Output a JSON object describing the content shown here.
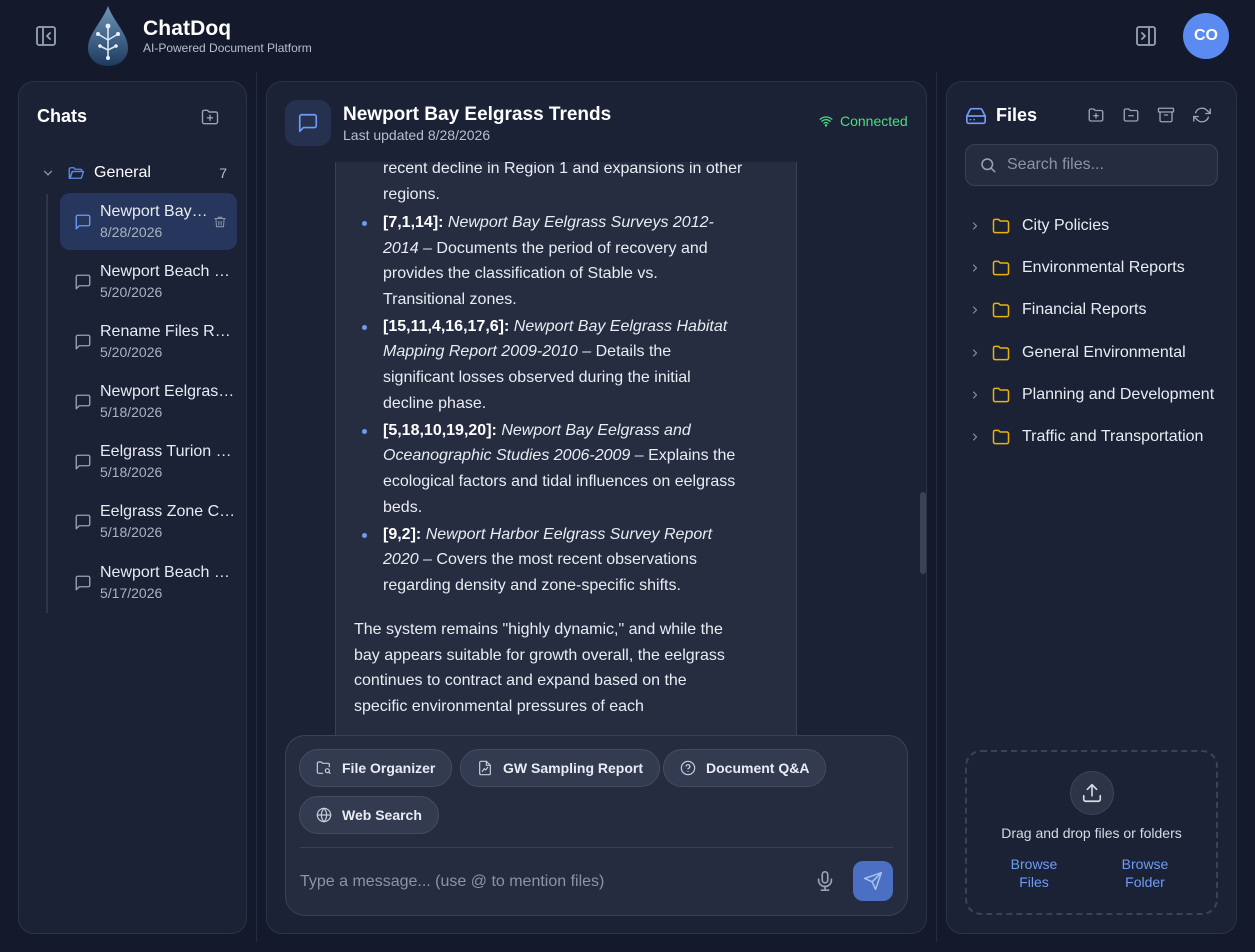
{
  "app": {
    "name": "ChatDoq",
    "tagline": "AI-Powered Document Platform",
    "avatar_initials": "CO",
    "accent": "#5b8bf0",
    "connected_color": "#4ade80",
    "folder_color": "#eab308"
  },
  "sidebar": {
    "title": "Chats",
    "folder": {
      "name": "General",
      "count": "7"
    },
    "chats": [
      {
        "title": "Newport Bay Eelgrass Trends",
        "date": "8/28/2026",
        "active": true
      },
      {
        "title": "Newport Beach Eelgrass",
        "date": "5/20/2026"
      },
      {
        "title": "Rename Files Request",
        "date": "5/20/2026"
      },
      {
        "title": "Newport Eelgrass Zones",
        "date": "5/18/2026"
      },
      {
        "title": "Eelgrass Turion Density",
        "date": "5/18/2026"
      },
      {
        "title": "Eelgrass Zone Classification",
        "date": "5/18/2026"
      },
      {
        "title": "Newport Beach Surveys",
        "date": "5/17/2026"
      }
    ]
  },
  "chat": {
    "title": "Newport Bay Eelgrass Trends",
    "updated": "Last updated 8/28/2026",
    "status": "Connected",
    "message": {
      "continuation": "recent decline in Region 1 and expansions in other regions.",
      "citations": [
        {
          "cite": "[7,1,14]:",
          "doc": "Newport Bay Eelgrass Surveys 2012-2014",
          "desc": "Documents the period of recovery and provides the classification of Stable vs. Transitional zones."
        },
        {
          "cite": "[15,11,4,16,17,6]:",
          "doc": "Newport Bay Eelgrass Habitat Mapping Report 2009-2010",
          "desc": "Details the significant losses observed during the initial decline phase."
        },
        {
          "cite": "[5,18,10,19,20]:",
          "doc": "Newport Bay Eelgrass and Oceanographic Studies 2006-2009",
          "desc": "Explains the ecological factors and tidal influences on eelgrass beds."
        },
        {
          "cite": "[9,2]:",
          "doc": "Newport Harbor Eelgrass Survey Report 2020",
          "desc": "Covers the most recent observations regarding density and zone-specific shifts."
        }
      ],
      "summary": "The system remains \"highly dynamic,\" and while the bay appears suitable for growth overall, the eelgrass continues to contract and expand based on the specific environmental pressures of each"
    },
    "quick_actions": [
      {
        "label": "File Organizer",
        "icon": "folder-search-icon"
      },
      {
        "label": "GW Sampling Report",
        "icon": "chart-file-icon"
      },
      {
        "label": "Document Q&A",
        "icon": "help-circle-icon"
      },
      {
        "label": "Web Search",
        "icon": "globe-icon"
      }
    ],
    "input_placeholder": "Type a message... (use @ to mention files)"
  },
  "files": {
    "title": "Files",
    "search_placeholder": "Search files...",
    "folders": [
      "City Policies",
      "Environmental Reports",
      "Financial Reports",
      "General Environmental",
      "Planning and Development",
      "Traffic and Transportation"
    ],
    "dropzone_text": "Drag and drop files or folders",
    "browse_files": "Browse Files",
    "browse_folder": "Browse Folder"
  }
}
